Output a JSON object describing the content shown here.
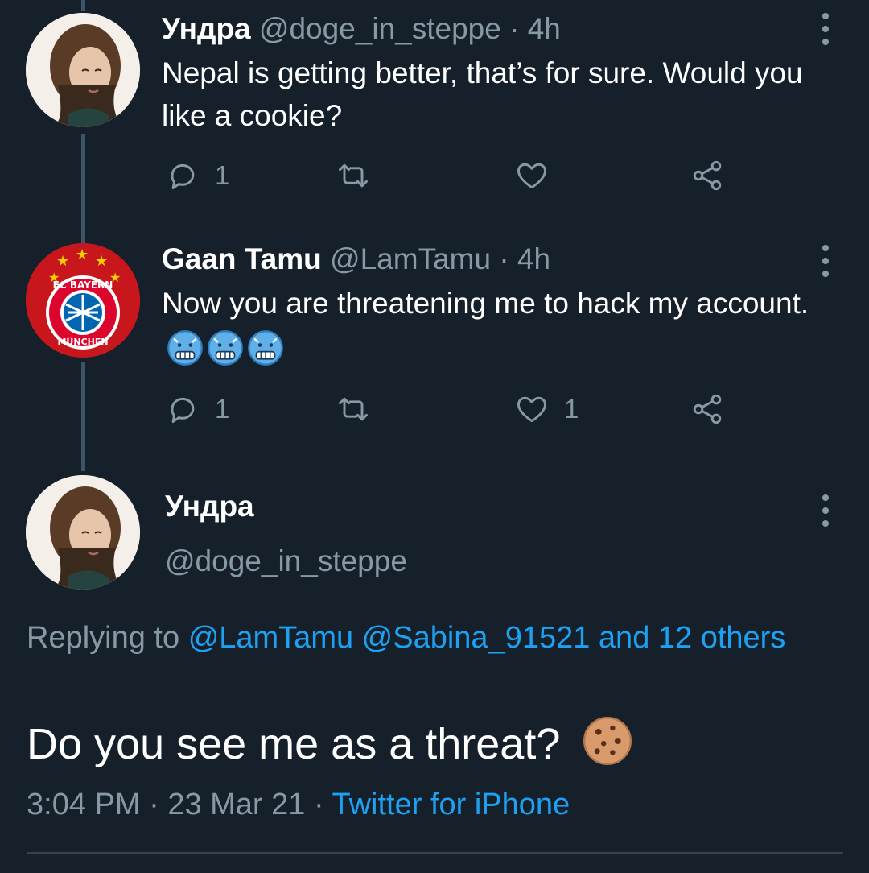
{
  "tweets": [
    {
      "display_name": "Ундра",
      "handle": "@doge_in_steppe",
      "sep": "·",
      "time": "4h",
      "text": "Nepal is getting better, that’s for sure. Would you like a cookie?",
      "reply_count": "1",
      "retweet_count": "",
      "like_count": ""
    },
    {
      "display_name": "Gaan Tamu",
      "handle": "@LamTamu",
      "sep": "·",
      "time": "4h",
      "text": "Now you are threatening me to hack my account.",
      "reply_count": "1",
      "retweet_count": "",
      "like_count": "1"
    }
  ],
  "avatar_badge": {
    "top_text": "FC BAYERN",
    "bottom_text": "MÜNCHEN"
  },
  "main_tweet": {
    "display_name": "Ундра",
    "handle": "@doge_in_steppe",
    "replying_prefix": "Replying to",
    "mentions": "@LamTamu @Sabina_91521 and 12 others",
    "text": "Do you see me as a threat?",
    "time": "3:04 PM",
    "sep1": "·",
    "date": "23 Mar 21",
    "sep2": "·",
    "source": "Twitter for iPhone"
  },
  "icons": {
    "reply": "reply-icon",
    "retweet": "retweet-icon",
    "like": "heart-icon",
    "share": "share-icon",
    "more": "more-vertical-icon",
    "emoji_cold": "cold-face-emoji-icon",
    "emoji_cookie": "cookie-emoji-icon"
  },
  "colors": {
    "background": "#15202b",
    "text_primary": "#ffffff",
    "text_secondary": "#8899a6",
    "link": "#1da1f2",
    "thread_line": "#3d5466"
  }
}
